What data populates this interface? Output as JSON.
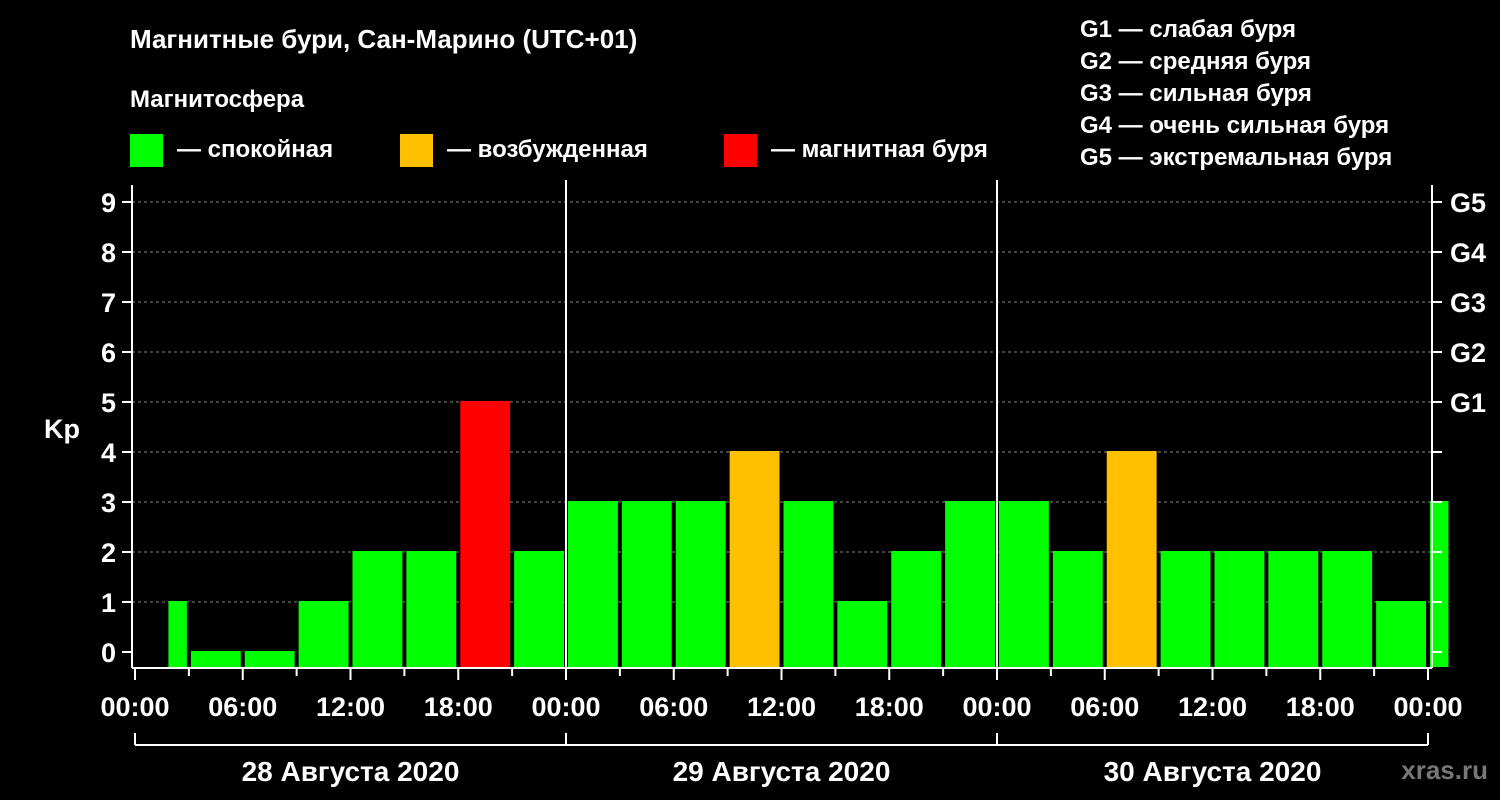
{
  "title": "Магнитные бури, Сан-Марино (UTC+01)",
  "subtitle": "Магнитосфера",
  "legend": [
    {
      "label": "— спокойная",
      "color": "#00ff00"
    },
    {
      "label": "— возбужденная",
      "color": "#ffc000"
    },
    {
      "label": "— магнитная буря",
      "color": "#ff0000"
    }
  ],
  "storm_scale": [
    "G1 — слабая буря",
    "G2 — средняя буря",
    "G3 — сильная буря",
    "G4 — очень сильная буря",
    "G5 — экстремальная буря"
  ],
  "watermark": "xras.ru",
  "chart_data": {
    "type": "bar",
    "ylabel": "Kp",
    "ylim": [
      0,
      9
    ],
    "yticks": [
      0,
      1,
      2,
      3,
      4,
      5,
      6,
      7,
      8,
      9
    ],
    "right_ticks": [
      {
        "value": 5,
        "label": "G1"
      },
      {
        "value": 6,
        "label": "G2"
      },
      {
        "value": 7,
        "label": "G3"
      },
      {
        "value": 8,
        "label": "G4"
      },
      {
        "value": 9,
        "label": "G5"
      }
    ],
    "xlim_hours": [
      0,
      72
    ],
    "xticks": [
      {
        "hour": 0,
        "label": "00:00"
      },
      {
        "hour": 6,
        "label": "06:00"
      },
      {
        "hour": 12,
        "label": "12:00"
      },
      {
        "hour": 18,
        "label": "18:00"
      },
      {
        "hour": 24,
        "label": "00:00"
      },
      {
        "hour": 30,
        "label": "06:00"
      },
      {
        "hour": 36,
        "label": "12:00"
      },
      {
        "hour": 42,
        "label": "18:00"
      },
      {
        "hour": 48,
        "label": "00:00"
      },
      {
        "hour": 54,
        "label": "06:00"
      },
      {
        "hour": 60,
        "label": "12:00"
      },
      {
        "hour": 66,
        "label": "18:00"
      },
      {
        "hour": 72,
        "label": "00:00"
      }
    ],
    "days": [
      "28 Августа 2020",
      "29 Августа 2020",
      "30 Августа 2020"
    ],
    "values": [
      1,
      0,
      0,
      1,
      2,
      2,
      5,
      2,
      3,
      3,
      3,
      4,
      3,
      1,
      2,
      3,
      3,
      2,
      4,
      2,
      2,
      2,
      2,
      1,
      3
    ],
    "levels": [
      "quiet",
      "quiet",
      "quiet",
      "quiet",
      "quiet",
      "quiet",
      "storm",
      "quiet",
      "quiet",
      "quiet",
      "quiet",
      "active",
      "quiet",
      "quiet",
      "quiet",
      "quiet",
      "quiet",
      "quiet",
      "active",
      "quiet",
      "quiet",
      "quiet",
      "quiet",
      "quiet",
      "quiet"
    ],
    "level_colors": {
      "quiet": "#00ff00",
      "active": "#ffc000",
      "storm": "#ff0000"
    },
    "grid": true
  }
}
